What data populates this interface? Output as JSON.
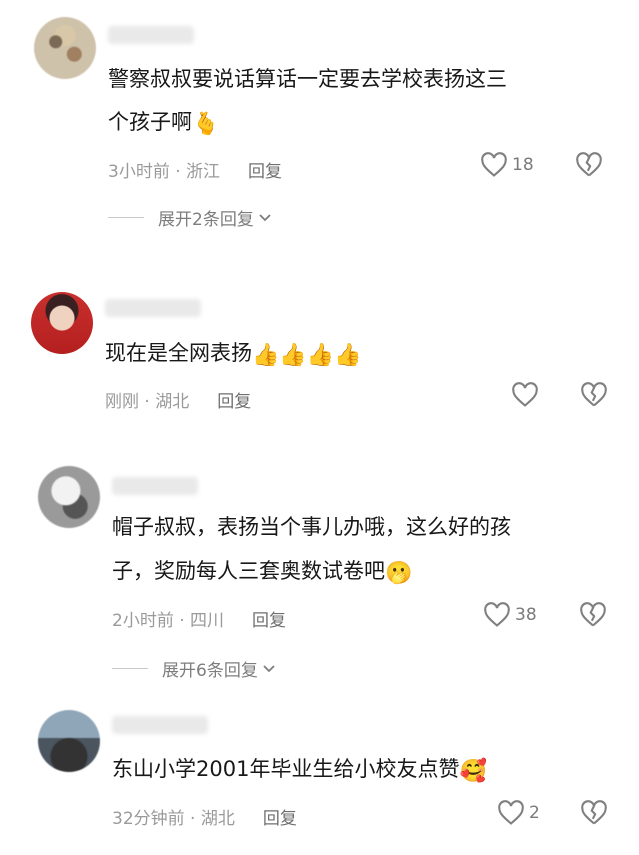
{
  "comments": [
    {
      "text_line1": "警察叔叔要说话算话一定要去学校表扬这三",
      "text_line2": "个孩子啊",
      "emoji": "🫰",
      "meta": "3小时前 · 浙江",
      "reply_label": "回复",
      "likes": "18",
      "expand_label": "展开2条回复"
    },
    {
      "text_line1": "现在是全网表扬",
      "emoji": "👍👍👍👍",
      "meta": "刚刚 · 湖北",
      "reply_label": "回复",
      "likes": ""
    },
    {
      "text_line1": "帽子叔叔，表扬当个事儿办哦，这么好的孩",
      "text_line2": "子，奖励每人三套奥数试卷吧",
      "emoji": "🫢",
      "meta": "2小时前 · 四川",
      "reply_label": "回复",
      "likes": "38",
      "expand_label": "展开6条回复"
    },
    {
      "text_line1": "东山小学2001年毕业生给小校友点赞",
      "emoji": "🥰",
      "meta": "32分钟前 · 湖北",
      "reply_label": "回复",
      "likes": "2"
    }
  ]
}
